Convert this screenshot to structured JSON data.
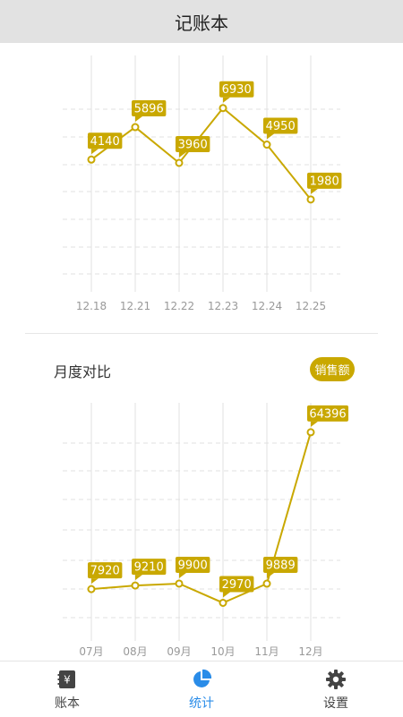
{
  "header": {
    "title": "记账本"
  },
  "section2": {
    "title": "月度对比",
    "badge": "销售额"
  },
  "tabs": [
    {
      "label": "账本",
      "icon": "yen-ledger-icon",
      "active": false
    },
    {
      "label": "统计",
      "icon": "pie-chart-icon",
      "active": true
    },
    {
      "label": "设置",
      "icon": "gear-icon",
      "active": false
    }
  ],
  "colors": {
    "accent": "#c9a800",
    "active_tab": "#2a8ce8",
    "grid": "#e0e0e0"
  },
  "chart_data": [
    {
      "type": "line",
      "categories": [
        "12.18",
        "12.21",
        "12.22",
        "12.23",
        "12.24",
        "12.25"
      ],
      "values": [
        4140,
        5896,
        3960,
        6930,
        4950,
        1980
      ],
      "ylim": [
        -2100,
        9000
      ],
      "grid": true
    },
    {
      "type": "line",
      "categories": [
        "07月",
        "08月",
        "09月",
        "10月",
        "11月",
        "12月"
      ],
      "values": [
        7920,
        9210,
        9900,
        2970,
        9889,
        64396
      ],
      "ylim": [
        -3000,
        75000
      ],
      "grid": true
    }
  ]
}
